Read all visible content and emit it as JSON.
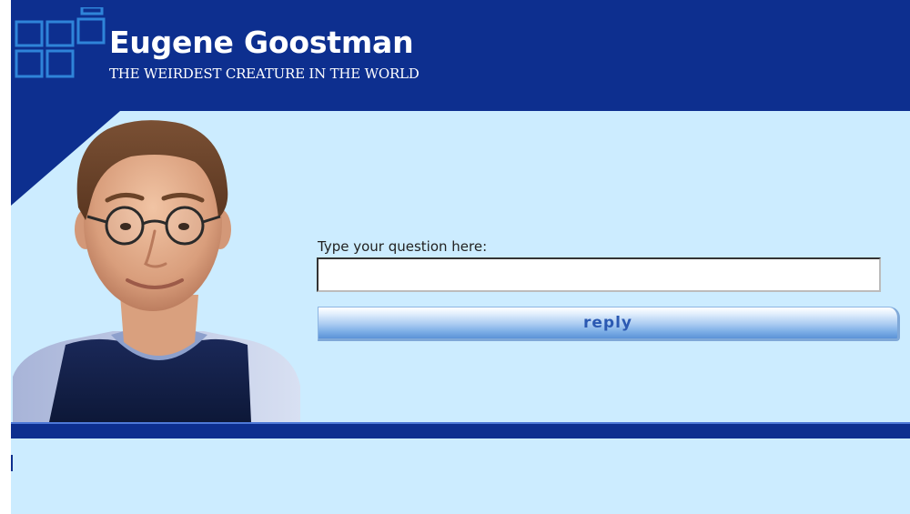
{
  "header": {
    "title": "Eugene Goostman",
    "subtitle": "THE WEIRDEST CREATURE IN THE WORLD"
  },
  "chat": {
    "prompt_label": "Type your question here:",
    "input_value": "",
    "input_placeholder": "",
    "reply_label": "reply"
  },
  "icons": {
    "logo": "blue-squares-logo-icon",
    "avatar": "eugene-avatar-image"
  },
  "colors": {
    "header_bg": "#0d2f8f",
    "panel_bg": "#ccecff",
    "button_text": "#2b59b2",
    "button_gradient_bottom": "#5b92d7"
  }
}
